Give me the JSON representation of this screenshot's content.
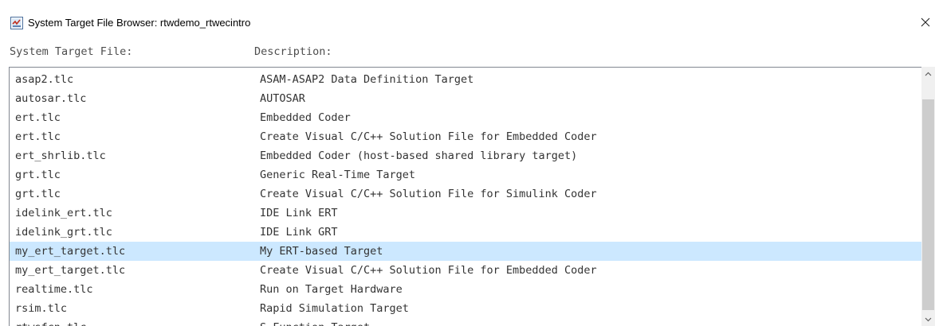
{
  "window": {
    "title": "System Target File Browser: rtwdemo_rtwecintro"
  },
  "columns": {
    "file_header": "System Target File:",
    "desc_header": "Description:"
  },
  "rows": [
    {
      "file": "asap2.tlc",
      "desc": "ASAM-ASAP2 Data Definition Target"
    },
    {
      "file": "autosar.tlc",
      "desc": "AUTOSAR"
    },
    {
      "file": "ert.tlc",
      "desc": "Embedded Coder"
    },
    {
      "file": "ert.tlc",
      "desc": "Create Visual C/C++ Solution File for Embedded Coder"
    },
    {
      "file": "ert_shrlib.tlc",
      "desc": "Embedded Coder (host-based shared library target)"
    },
    {
      "file": "grt.tlc",
      "desc": "Generic Real-Time Target"
    },
    {
      "file": "grt.tlc",
      "desc": "Create Visual C/C++ Solution File for Simulink Coder"
    },
    {
      "file": "idelink_ert.tlc",
      "desc": "IDE Link ERT"
    },
    {
      "file": "idelink_grt.tlc",
      "desc": "IDE Link GRT"
    },
    {
      "file": "my_ert_target.tlc",
      "desc": "My ERT-based Target"
    },
    {
      "file": "my_ert_target.tlc",
      "desc": "Create Visual C/C++ Solution File for Embedded Coder"
    },
    {
      "file": "realtime.tlc",
      "desc": "Run on Target Hardware"
    },
    {
      "file": "rsim.tlc",
      "desc": "Rapid Simulation Target"
    },
    {
      "file": "rtwsfcn.tlc",
      "desc": "S-Function Target"
    }
  ],
  "selected_index": 9,
  "colors": {
    "selection": "#cce8ff",
    "header_text": "#4d4d4d",
    "row_text": "#333333"
  },
  "icons": {
    "app": "simulink-app-icon",
    "close": "close-icon",
    "scroll_up": "chevron-up-icon",
    "scroll_down": "chevron-down-icon"
  }
}
